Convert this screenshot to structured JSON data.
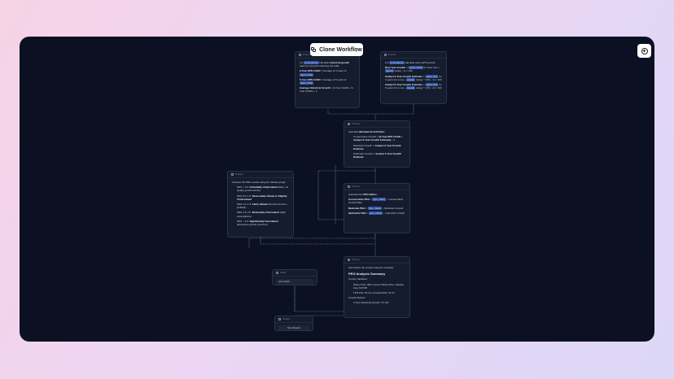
{
  "toolbar": {
    "clone_label": "Clone Workflow"
  },
  "nodes": {
    "historical": {
      "header": "Prompt",
      "intro_pre": "For",
      "intro_hl": "{{company}}",
      "intro_mid": "calculate",
      "intro_bold": "historical growth",
      "intro_post": "rates by using the following formulas:",
      "l1_bold": "3-Year EPS CAGR",
      "l1_rest": "= Average of 3 years of",
      "l1_hl": "{{eps_hist}}",
      "l2_bold": "5-Year EPS CAGR",
      "l2_rest": "= Average of 5 years of",
      "l2_hl": "{{eps_hist}}",
      "l3_bold": "Average Historical Growth",
      "l3_rest": "= (3-Year CAGR + 5-Year CAGR) ÷ 2"
    },
    "future": {
      "header": "Prompt",
      "intro_pre": "For",
      "intro_hl": "{{company}}",
      "intro_post": "calculate future EPS growth:",
      "l1_bold": "Next Year Growth",
      "l1_a": "= (",
      "l1_hl1": "{{eps_fwd}}",
      "l1_b": "for Next Year ÷",
      "l1_hl2": "{{eps}}",
      "l1_c": "today) - 1) × 100",
      "l2_bold": "Analyst 3-Year Growth Estimate",
      "l2_a": "= (",
      "l2_hl1": "{{eps_3y}}",
      "l2_b": "for 3 years from now ÷",
      "l2_hl2": "{{eps}}",
      "l2_c": "today) ^ (1/3) - 1) × 100",
      "l3_bold": "Analyst 5-Year Growth Estimate",
      "l3_a": "= (",
      "l3_hl1": "{{eps_5y}}",
      "l3_b": "for 5 years from now ÷",
      "l3_hl2": "{{eps}}",
      "l3_c": "today) ^ (1/5) - 1) × 100"
    },
    "blended": {
      "header": "Prompt",
      "intro_pre": "Calculate",
      "intro_bold": "Blended Growth Rate:",
      "i1_a": "Conservative Growth =",
      "i1_bold": "(3-Year EPS CAGR + Analyst 3-Year Growth Estimate)",
      "i1_c": "÷ 2",
      "i2_a": "Moderate Growth =",
      "i2_bold": "Analyst 3-Year Growth Estimate",
      "i3_a": "Optimistic Growth =",
      "i3_bold": "Analyst 5-Year Growth Estimate"
    },
    "interpret": {
      "header": "Prompt",
      "intro": "Interpret the PEG results using the following logic:",
      "r1_a": "PEG < 0.5:",
      "r1_bold": "Potentially Undervalued",
      "r1_c": "(Rare, for quality growth stocks)",
      "r2_a": "PEG 0.5–1.0:",
      "r2_bold": "Reasonably Valued to Slightly Undervalued",
      "r3_a": "PEG 1.0–1.5:",
      "r3_bold": "Fairly Valued",
      "r3_c": "(Growth premium justified)",
      "r4_a": "PEG 1.5–2.0:",
      "r4_bold": "Moderately Overvalued",
      "r4_c": "(High expectations)",
      "r5_a": "PEG > 2.0:",
      "r5_bold": "Significantly Overvalued",
      "r5_c": "(Excessive growth premium)"
    },
    "peg": {
      "header": "Prompt",
      "intro_pre": "Calculate the",
      "intro_bold": "PEG Ratios:",
      "l1_bold": "Conservative PEG",
      "l1_a": "=",
      "l1_hl": "{{pe_ratio}}",
      "l1_c": "÷ Conservative Growth Rate",
      "l2_bold": "Moderate PEG",
      "l2_a": "=",
      "l2_hl": "{{pe_ratio}}",
      "l2_c": "÷ Moderate Growth",
      "l3_bold": "Optimistic PEG",
      "l3_a": "=",
      "l3_hl": "{{pe_ratio}}",
      "l3_c": "÷ Optimistic Growth"
    },
    "linechart": {
      "header": "Chart",
      "value": "Line Chart"
    },
    "summary": {
      "header": "Prompt",
      "intro": "Summarize the results using the template:",
      "title": "PEG Analysis Summary",
      "s1": "Current Valuation:",
      "s2": "Share Price: $XX Current Share Price | Market Cap: $XXXB",
      "s3": "TTM P/E: XX.Xx | Forward P/E: XX.Xx",
      "s4": "Growth Metrics:",
      "s5": "3-Year Historical Growth: XX.X%"
    },
    "report": {
      "header": "Output",
      "value": "New Report"
    }
  },
  "colors": {
    "window": "#0b1123",
    "node": "#151c2e",
    "highlight": "#2d4d9c",
    "wire": "#8a93a8"
  }
}
